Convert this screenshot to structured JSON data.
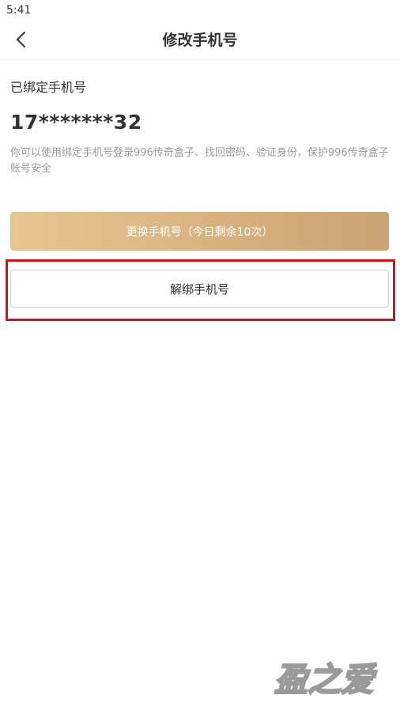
{
  "status_bar": {
    "time": "5:41"
  },
  "header": {
    "title": "修改手机号",
    "back_icon": "chevron-left-icon"
  },
  "main": {
    "bound_label": "已绑定手机号",
    "phone_number": "17*******32",
    "description": "你可以使用绑定手机号登录996传奇盒子、找回密码、验证身份，保护996传奇盒子账号安全",
    "change_button_label": "更换手机号（今日剩余10次）",
    "unbind_button_label": "解绑手机号"
  },
  "watermark": {
    "text": "盈之爱"
  },
  "colors": {
    "accent_gradient_start": "#e8c590",
    "accent_gradient_end": "#c9a373",
    "highlight": "#d0121b"
  }
}
